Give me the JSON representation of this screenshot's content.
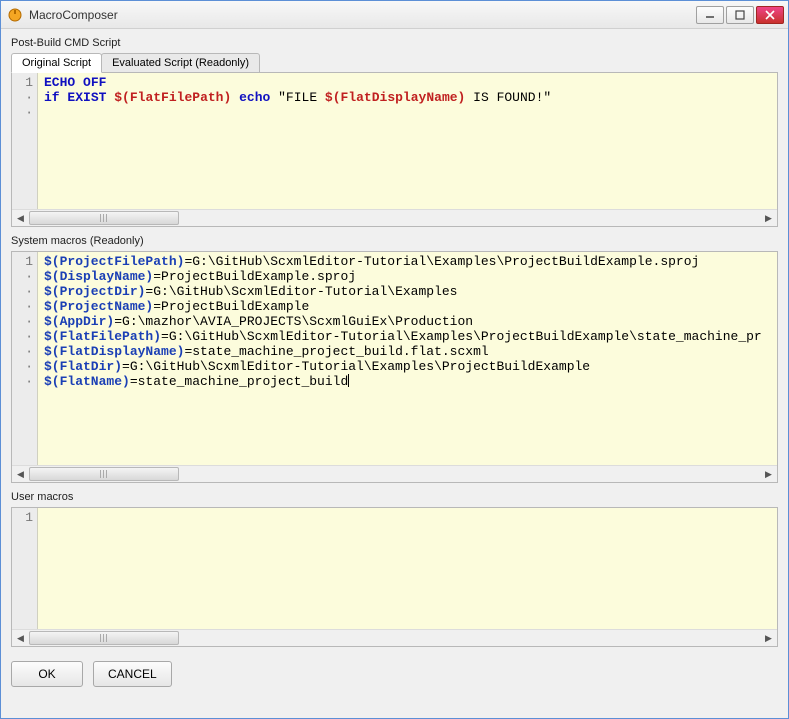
{
  "window": {
    "title": "MacroComposer"
  },
  "section_labels": {
    "post_build": "Post-Build CMD Script",
    "system_macros": "System macros (Readonly)",
    "user_macros": "User macros"
  },
  "tabs": {
    "original": "Original Script",
    "evaluated": "Evaluated Script (Readonly)"
  },
  "original_script": {
    "gutter": "1\n·\n·",
    "tokens": {
      "echo": "ECHO",
      "off": "OFF",
      "if": "if",
      "exist": "EXIST",
      "macro1": "$(FlatFilePath)",
      "echo2": "echo",
      "str_a": "\"FILE ",
      "macro2": "$(FlatDisplayName)",
      "str_b": " IS FOUND!\""
    }
  },
  "system_macros": {
    "gutter": "1\n·\n·\n·\n·\n·\n·\n·\n·",
    "lines": [
      {
        "key": "$(ProjectFilePath)",
        "val": "=G:\\GitHub\\ScxmlEditor-Tutorial\\Examples\\ProjectBuildExample.sproj"
      },
      {
        "key": "$(DisplayName)",
        "val": "=ProjectBuildExample.sproj"
      },
      {
        "key": "$(ProjectDir)",
        "val": "=G:\\GitHub\\ScxmlEditor-Tutorial\\Examples"
      },
      {
        "key": "$(ProjectName)",
        "val": "=ProjectBuildExample"
      },
      {
        "key": "$(AppDir)",
        "val": "=G:\\mazhor\\AVIA_PROJECTS\\ScxmlGuiEx\\Production"
      },
      {
        "key": "$(FlatFilePath)",
        "val": "=G:\\GitHub\\ScxmlEditor-Tutorial\\Examples\\ProjectBuildExample\\state_machine_pr"
      },
      {
        "key": "$(FlatDisplayName)",
        "val": "=state_machine_project_build.flat.scxml"
      },
      {
        "key": "$(FlatDir)",
        "val": "=G:\\GitHub\\ScxmlEditor-Tutorial\\Examples\\ProjectBuildExample"
      },
      {
        "key": "$(FlatName)",
        "val": "=state_machine_project_build"
      }
    ]
  },
  "user_macros": {
    "gutter": "1"
  },
  "buttons": {
    "ok": "OK",
    "cancel": "CANCEL"
  }
}
